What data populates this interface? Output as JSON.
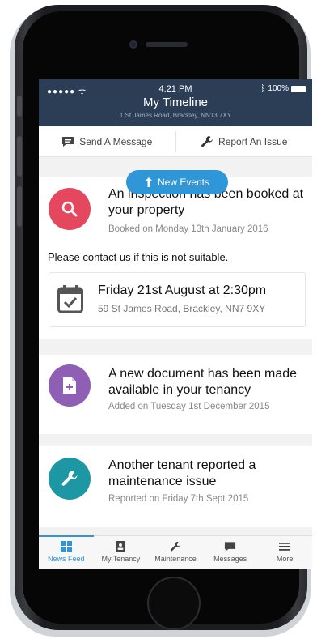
{
  "status_bar": {
    "signal": "●●●●● ᯤ",
    "time": "4:21 PM",
    "battery": "100%",
    "bluetooth": "bluetooth-icon"
  },
  "header": {
    "title": "My Timeline",
    "subtitle": "1 St James Road, Brackley, NN13 7XY"
  },
  "actions": {
    "send_message": "Send A Message",
    "report_issue": "Report An Issue"
  },
  "new_events": "New Events",
  "cards": [
    {
      "icon": "search-icon",
      "color": "#e5485e",
      "title": "An inspection has been booked at your property",
      "meta": "Booked on Monday 13th January 2016",
      "note": "Please contact us if this is not suitable.",
      "appointment": {
        "icon": "calendar-check-icon",
        "title": "Friday 21st August at 2:30pm",
        "address": "59 St James Road, Brackley, NN7 9XY"
      }
    },
    {
      "icon": "document-add-icon",
      "color": "#8e5fb4",
      "title": "A new document has been made available in your tenancy",
      "meta": "Added on Tuesday 1st December 2015"
    },
    {
      "icon": "wrench-icon",
      "color": "#1e97a4",
      "title": "Another tenant reported a maintenance issue",
      "meta": "Reported on Friday 7th Sept 2015"
    }
  ],
  "tabs": [
    {
      "label": "News Feed",
      "icon": "grid-icon",
      "active": true
    },
    {
      "label": "My Tenancy",
      "icon": "contact-card-icon",
      "active": false
    },
    {
      "label": "Maintenance",
      "icon": "wrench-icon",
      "active": false
    },
    {
      "label": "Messages",
      "icon": "chat-icon",
      "active": false
    },
    {
      "label": "More",
      "icon": "menu-icon",
      "active": false
    }
  ],
  "colors": {
    "header": "#2c3e56",
    "accent": "#2f96d8"
  }
}
